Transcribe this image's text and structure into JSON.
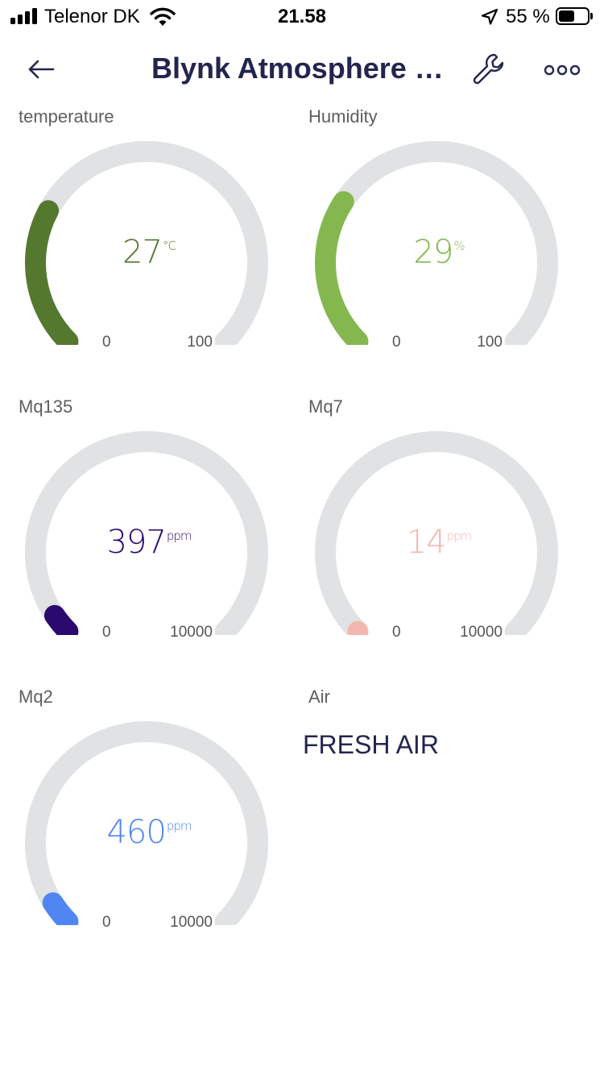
{
  "status": {
    "carrier": "Telenor DK",
    "time": "21.58",
    "battery_text": "55 %",
    "battery_level": 0.55
  },
  "header": {
    "title": "Blynk Atmosphere da...",
    "back_icon": "arrow-left-icon",
    "settings_icon": "wrench-icon",
    "more_icon": "more-dots-icon"
  },
  "widgets": [
    {
      "label": "temperature",
      "value": "27",
      "unit": "°C",
      "min": "0",
      "max": "100",
      "level": 0.27,
      "color": "#55782f"
    },
    {
      "label": "Humidity",
      "value": "29",
      "unit": "%",
      "min": "0",
      "max": "100",
      "level": 0.29,
      "color": "#84b84f"
    },
    {
      "label": "Mq135",
      "value": "397",
      "unit": "ppm",
      "min": "0",
      "max": "10000",
      "level": 0.0397,
      "color": "#2a0a6e"
    },
    {
      "label": "Mq7",
      "value": "14",
      "unit": "ppm",
      "min": "0",
      "max": "10000",
      "level": 0.0014,
      "color": "#f2b8b0"
    },
    {
      "label": "Mq2",
      "value": "460",
      "unit": "ppm",
      "min": "0",
      "max": "10000",
      "level": 0.046,
      "color": "#4f86f2"
    }
  ],
  "air": {
    "label": "Air",
    "text": "FRESH AIR"
  },
  "colors": {
    "track": "#e1e2e4",
    "title": "#23254f"
  }
}
